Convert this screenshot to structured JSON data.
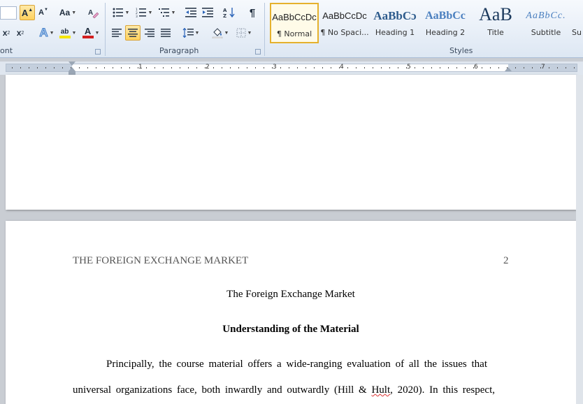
{
  "ribbon": {
    "font_group_label": "ont",
    "paragraph_group_label": "Paragraph",
    "styles_group_label": "Styles",
    "font_controls": {
      "grow_font": "A",
      "shrink_font": "A",
      "change_case": "Aa",
      "subscript": "x",
      "superscript": "x",
      "subscript_mark": "2",
      "superscript_mark": "2",
      "text_effects": "A",
      "highlight": "ab",
      "font_color": "A"
    },
    "paragraph_controls": {
      "pilcrow": "¶"
    },
    "styles": [
      {
        "sample": "AaBbCcDc",
        "name": "¶ Normal",
        "selected": true
      },
      {
        "sample": "AaBbCcDc",
        "name": "¶ No Spaci...",
        "selected": false
      },
      {
        "sample": "AaBbCɔ",
        "name": "Heading 1",
        "selected": false
      },
      {
        "sample": "AaBbCc",
        "name": "Heading 2",
        "selected": false
      },
      {
        "sample": "AaB",
        "name": "Title",
        "selected": false
      },
      {
        "sample": "AaBbCc.",
        "name": "Subtitle",
        "selected": false
      },
      {
        "sample": "",
        "name": "Su",
        "selected": false
      }
    ],
    "colors": {
      "highlight": "#f5e500",
      "font_color": "#d21f1f",
      "selection": "#e5b12d"
    }
  },
  "ruler": {
    "numbers": [
      "1",
      "2",
      "3",
      "4",
      "5",
      "6",
      "7"
    ]
  },
  "document": {
    "header_text": "THE FOREIGN EXCHANGE MARKET",
    "page_number": "2",
    "title": "The Foreign Exchange Market",
    "heading": "Understanding of the Material",
    "body_line_1": "Principally, the course material offers a wide-ranging evaluation of all the issues that",
    "body_line_2_a": "universal organizations face, both inwardly and outwardly (Hill & ",
    "body_line_2_b": "Hult",
    "body_line_2_c": ", 2020). In this respect,"
  }
}
